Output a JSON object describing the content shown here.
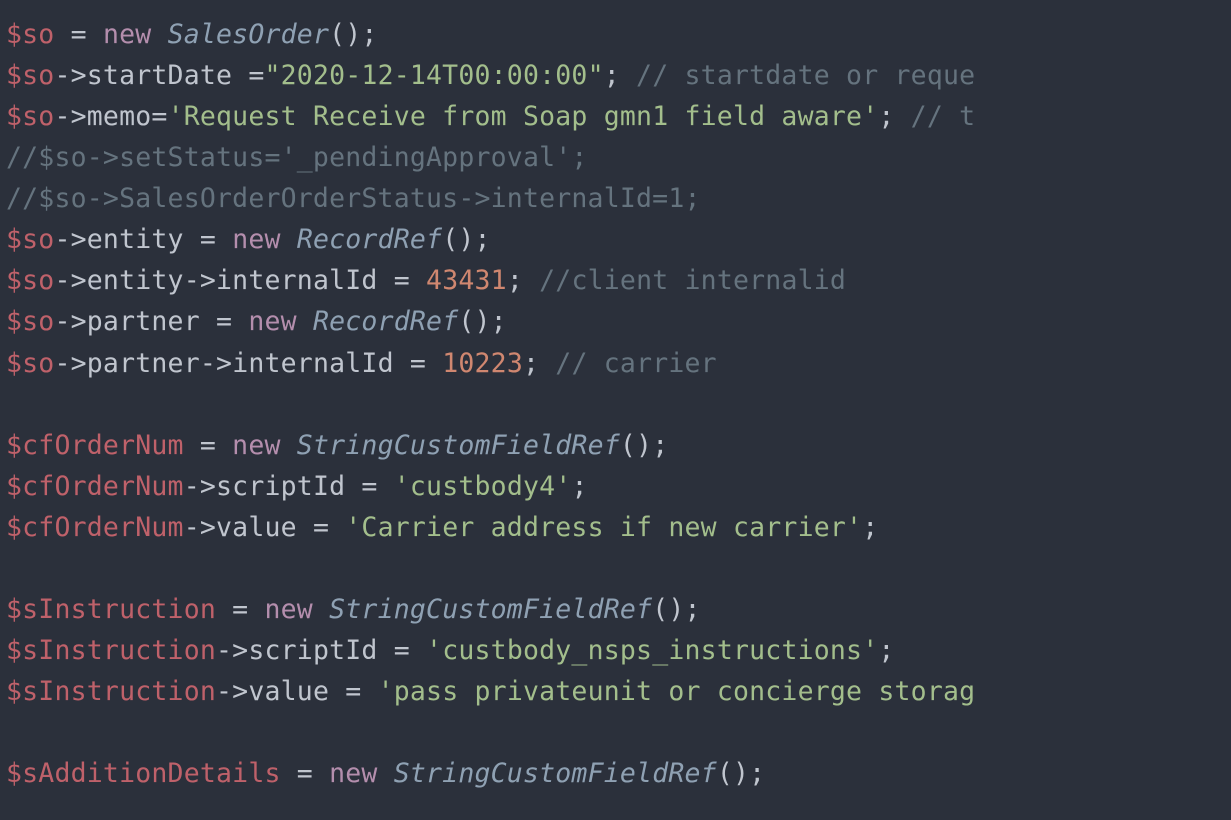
{
  "code": {
    "line1": {
      "v1": "$so",
      "eq": " = ",
      "kw": "new",
      "sp": " ",
      "cls": "SalesOrder",
      "tail": "();"
    },
    "line2": {
      "v1": "$so",
      "arrow": "->",
      "prop": "startDate",
      "eq": " =",
      "str": "\"2020-12-14T00:00:00\"",
      "semi": "; ",
      "cmt": "// startdate or reque"
    },
    "line3": {
      "v1": "$so",
      "arrow": "->",
      "prop": "memo",
      "eq": "=",
      "str": "'Request Receive from Soap gmn1 field aware'",
      "semi": "; ",
      "cmt": "// t"
    },
    "line4": {
      "cmt": "//$so->setStatus='_pendingApproval';"
    },
    "line5": {
      "cmt": "//$so->SalesOrderOrderStatus->internalId=1;"
    },
    "line6": {
      "v1": "$so",
      "arrow": "->",
      "prop": "entity",
      "eq": " = ",
      "kw": "new",
      "sp": " ",
      "cls": "RecordRef",
      "tail": "();"
    },
    "line7": {
      "v1": "$so",
      "arrow1": "->",
      "prop1": "entity",
      "arrow2": "->",
      "prop2": "internalId",
      "eq": " = ",
      "num": "43431",
      "semi": "; ",
      "cmt": "//client internalid"
    },
    "line8": {
      "v1": "$so",
      "arrow": "->",
      "prop": "partner",
      "eq": " = ",
      "kw": "new",
      "sp": " ",
      "cls": "RecordRef",
      "tail": "();"
    },
    "line9": {
      "v1": "$so",
      "arrow1": "->",
      "prop1": "partner",
      "arrow2": "->",
      "prop2": "internalId",
      "eq": " = ",
      "num": "10223",
      "semi": "; ",
      "cmt": "// carrier"
    },
    "line10": {
      "blank": " "
    },
    "line11": {
      "v1": "$cfOrderNum",
      "eq": " = ",
      "kw": "new",
      "sp": " ",
      "cls": "StringCustomFieldRef",
      "tail": "();"
    },
    "line12": {
      "v1": "$cfOrderNum",
      "arrow": "->",
      "prop": "scriptId",
      "eq": " = ",
      "str": "'custbody4'",
      "semi": ";"
    },
    "line13": {
      "v1": "$cfOrderNum",
      "arrow": "->",
      "prop": "value",
      "eq": " = ",
      "str": "'Carrier address if new carrier'",
      "semi": ";"
    },
    "line14": {
      "blank": " "
    },
    "line15": {
      "v1": "$sInstruction",
      "eq": " = ",
      "kw": "new",
      "sp": " ",
      "cls": "StringCustomFieldRef",
      "tail": "();"
    },
    "line16": {
      "v1": "$sInstruction",
      "arrow": "->",
      "prop": "scriptId",
      "eq": " = ",
      "str": "'custbody_nsps_instructions'",
      "semi": ";"
    },
    "line17": {
      "v1": "$sInstruction",
      "arrow": "->",
      "prop": "value",
      "eq": " = ",
      "str": "'pass privateunit or concierge storag"
    },
    "line18": {
      "blank": " "
    },
    "line19": {
      "v1": "$sAdditionDetails",
      "eq": " = ",
      "kw": "new",
      "sp": " ",
      "cls": "StringCustomFieldRef",
      "tail": "();"
    }
  }
}
